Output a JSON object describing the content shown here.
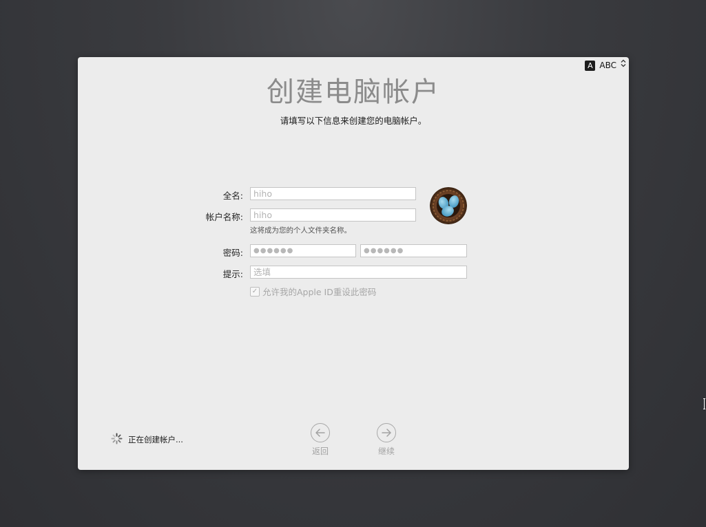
{
  "input_source": {
    "badge": "A",
    "label": "ABC",
    "chevron": "⌃⌄"
  },
  "header": {
    "title": "创建电脑帐户",
    "subtitle": "请填写以下信息来创建您的电脑帐户。"
  },
  "form": {
    "full_name": {
      "label": "全名:",
      "value": "hiho"
    },
    "account_name": {
      "label": "帐户名称:",
      "value": "hiho",
      "hint": "这将成为您的个人文件夹名称。"
    },
    "password": {
      "label": "密码:",
      "value": "●●●●●●",
      "verify": "●●●●●●"
    },
    "hint": {
      "label": "提示:",
      "placeholder": "选填"
    },
    "apple_id_reset": {
      "label": "允许我的Apple ID重设此密码",
      "checked": true,
      "check_glyph": "✓"
    }
  },
  "avatar": {
    "icon": "bird-nest-eggs-avatar"
  },
  "status": {
    "text": "正在创建帐户..."
  },
  "nav": {
    "back": {
      "label": "返回",
      "icon": "arrow-left-icon"
    },
    "continue": {
      "label": "继续",
      "icon": "arrow-right-icon"
    }
  },
  "colors": {
    "background": "#3a3b3f",
    "panel": "#ececec",
    "accent_gray": "#8b8b8b"
  }
}
